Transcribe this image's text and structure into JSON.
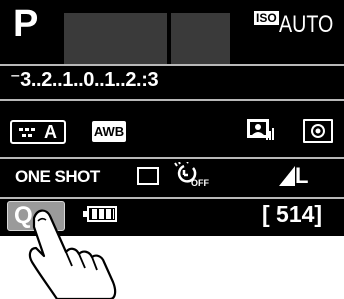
{
  "shooting_mode": "P",
  "iso": {
    "badge": "ISO",
    "value": "AUTO"
  },
  "exposure_scale": "⁻3..2..1..0..1..2.:3",
  "picture_style": {
    "label": "A",
    "icon": "picture-style-icon"
  },
  "white_balance": "AWB",
  "auto_lighting_optimizer": {
    "icon": "auto-lighting-optimizer-icon"
  },
  "metering": {
    "icon": "evaluative-metering-icon"
  },
  "af_mode": "ONE SHOT",
  "drive_mode": {
    "icon": "single-shot-drive-icon"
  },
  "self_timer": {
    "icon": "self-timer-icon",
    "label": "OFF"
  },
  "image_quality": {
    "icon": "large-fine-quality-icon",
    "label": "L"
  },
  "quick_control": {
    "label": "Q",
    "icon": "quick-control-button"
  },
  "battery": {
    "icon": "battery-icon",
    "level": 1.0
  },
  "shots_remaining": "[ 514]",
  "colors": {
    "screen_bg": "#000000",
    "fg": "#ffffff",
    "qbutton_bg": "#9a9a9a",
    "divider": "#b8b8b8"
  }
}
